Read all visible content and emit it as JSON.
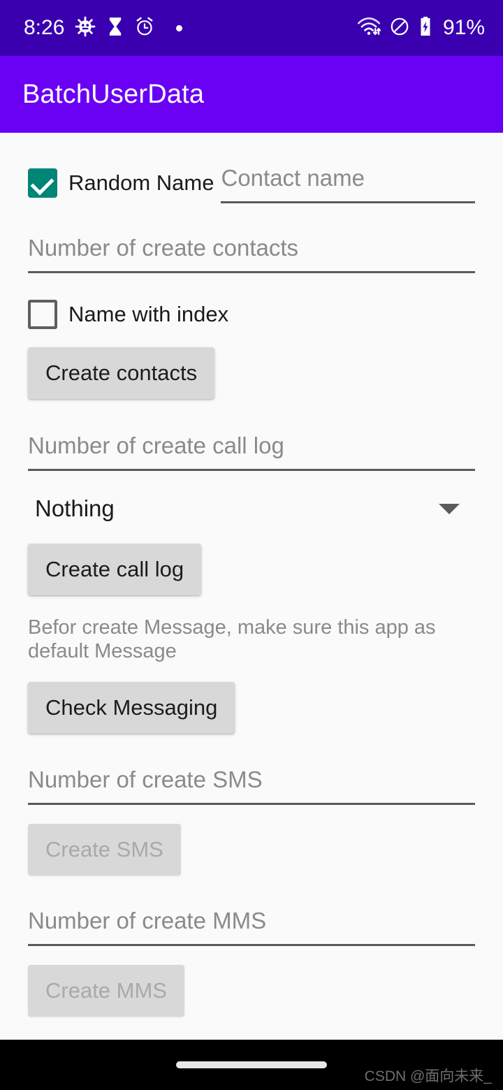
{
  "status_bar": {
    "time": "8:26",
    "battery_percent": "91%",
    "icons": [
      "android-debug-icon",
      "hourglass-icon",
      "alarm-clock-icon",
      "dot-indicator-icon",
      "wifi-icon",
      "do-not-disturb-icon",
      "battery-charging-icon"
    ],
    "background_color": "#3a00b0"
  },
  "app_bar": {
    "title": "BatchUserData",
    "background_color": "#6a00f4",
    "text_color": "#ffffff"
  },
  "form": {
    "random_name": {
      "label": "Random Name",
      "checked": true,
      "checkbox_color": "#008577"
    },
    "contact_name": {
      "placeholder": "Contact name",
      "value": ""
    },
    "number_of_contacts": {
      "placeholder": "Number of create contacts",
      "value": ""
    },
    "name_with_index": {
      "label": "Name with index",
      "checked": false
    },
    "create_contacts_button": {
      "label": "Create contacts",
      "enabled": true
    },
    "number_of_call_log": {
      "placeholder": "Number of create call log",
      "value": ""
    },
    "call_log_type_spinner": {
      "selected": "Nothing",
      "options": [
        "Nothing"
      ]
    },
    "create_call_log_button": {
      "label": "Create call log",
      "enabled": true
    },
    "messaging_hint": "Befor create Message, make sure this app as default Message",
    "check_messaging_button": {
      "label": "Check Messaging",
      "enabled": true
    },
    "number_of_sms": {
      "placeholder": "Number of create SMS",
      "value": ""
    },
    "create_sms_button": {
      "label": "Create SMS",
      "enabled": false
    },
    "number_of_mms": {
      "placeholder": "Number of create MMS",
      "value": ""
    },
    "create_mms_button": {
      "label": "Create MMS",
      "enabled": false
    }
  },
  "nav_bar": {
    "home_indicator": "home-indicator",
    "background_color": "#000000"
  },
  "watermark": "CSDN @面向未来_"
}
